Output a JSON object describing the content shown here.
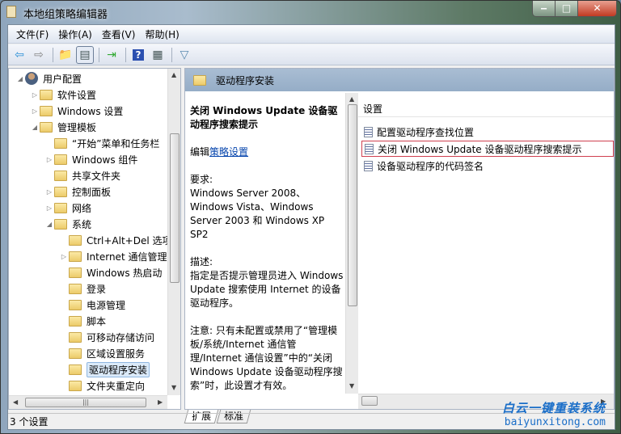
{
  "window": {
    "title": "本地组策略编辑器",
    "minimize": "‒",
    "maximize": "□",
    "close": "✕"
  },
  "menu": [
    "文件(F)",
    "操作(A)",
    "查看(V)",
    "帮助(H)"
  ],
  "toolbar": [
    {
      "icon": "back-icon",
      "glyph": "⇦",
      "color": "#2a8fd6"
    },
    {
      "icon": "forward-icon",
      "glyph": "⇨",
      "color": "#888888"
    },
    {
      "icon": "up-folder-icon",
      "glyph": "📁",
      "color": "#c9a64a"
    },
    {
      "icon": "show-hide-tree-icon",
      "glyph": "▤",
      "color": "#455"
    },
    {
      "icon": "export-list-icon",
      "glyph": "⇥",
      "color": "#3a3"
    },
    {
      "icon": "help-icon",
      "glyph": "?",
      "color": "#fff"
    },
    {
      "icon": "action-pane-icon",
      "glyph": "▦",
      "color": "#455"
    },
    {
      "icon": "filter-icon",
      "glyph": "▽",
      "color": "#5a8ab0"
    }
  ],
  "tree": [
    {
      "label": "用户配置",
      "level": 0,
      "arrow": "◢",
      "icon": "user"
    },
    {
      "label": "软件设置",
      "level": 1,
      "arrow": "▷"
    },
    {
      "label": "Windows 设置",
      "level": 1,
      "arrow": "▷"
    },
    {
      "label": "管理模板",
      "level": 1,
      "arrow": "◢"
    },
    {
      "label": "“开始”菜单和任务栏",
      "level": 2,
      "arrow": ""
    },
    {
      "label": "Windows 组件",
      "level": 2,
      "arrow": "▷"
    },
    {
      "label": "共享文件夹",
      "level": 2,
      "arrow": ""
    },
    {
      "label": "控制面板",
      "level": 2,
      "arrow": "▷"
    },
    {
      "label": "网络",
      "level": 2,
      "arrow": "▷"
    },
    {
      "label": "系统",
      "level": 2,
      "arrow": "◢"
    },
    {
      "label": "Ctrl+Alt+Del 选项",
      "level": 3,
      "arrow": ""
    },
    {
      "label": "Internet 通信管理",
      "level": 3,
      "arrow": "▷"
    },
    {
      "label": "Windows 热启动",
      "level": 3,
      "arrow": ""
    },
    {
      "label": "登录",
      "level": 3,
      "arrow": ""
    },
    {
      "label": "电源管理",
      "level": 3,
      "arrow": ""
    },
    {
      "label": "脚本",
      "level": 3,
      "arrow": ""
    },
    {
      "label": "可移动存储访问",
      "level": 3,
      "arrow": ""
    },
    {
      "label": "区域设置服务",
      "level": 3,
      "arrow": ""
    },
    {
      "label": "驱动程序安装",
      "level": 3,
      "arrow": "",
      "selected": true
    },
    {
      "label": "文件夹重定向",
      "level": 3,
      "arrow": ""
    }
  ],
  "right": {
    "header": "驱动程序安装",
    "desc": {
      "title": "关闭 Windows Update 设备驱动程序搜索提示",
      "edit_prefix": "编辑",
      "edit_link": "策略设置",
      "req_label": "要求:",
      "req_text": "Windows Server 2008、Windows Vista、Windows Server 2003 和 Windows XP SP2",
      "desc_label": "描述:",
      "desc_text": "指定是否提示管理员进入 Windows Update 搜索使用 Internet 的设备驱动程序。",
      "note": "注意: 只有未配置或禁用了“管理模板/系统/Internet 通信管理/Internet 通信设置”中的“关闭 Windows Update 设备驱动程序搜索”时，此设置才有效。"
    },
    "list_header": "设置",
    "items": [
      "配置驱动程序查找位置",
      "关闭 Windows Update 设备驱动程序搜索提示",
      "设备驱动程序的代码签名"
    ],
    "highlight_color": "#d04050"
  },
  "tabs": [
    "扩展",
    "标准"
  ],
  "status": "3 个设置",
  "watermark": {
    "line1": "白云一键重装系统",
    "line2": "baiyunxitong.com"
  }
}
